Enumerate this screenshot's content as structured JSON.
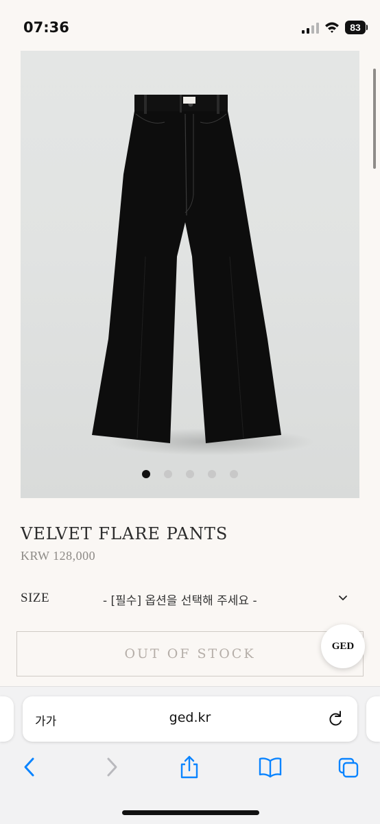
{
  "status_bar": {
    "time": "07:36",
    "battery": "83"
  },
  "product": {
    "title": "VELVET FLARE PANTS",
    "price": "KRW 128,000",
    "image_label_icon": "ged-label-tag",
    "gallery": {
      "slide_count": 5,
      "active_index": 0
    }
  },
  "options": {
    "size_label": "SIZE",
    "size_select_value": "- [필수] 옵션을 선택해 주세요 -"
  },
  "cta": {
    "out_of_stock_label": "OUT OF STOCK"
  },
  "chat_bubble": {
    "label": "GED"
  },
  "browser": {
    "text_size_label": "가가",
    "url": "ged.kr",
    "icons": [
      "back-icon",
      "forward-icon",
      "share-icon",
      "bookmarks-icon",
      "tabs-icon",
      "reload-icon"
    ]
  },
  "colors": {
    "page_bg": "#faf7f4",
    "accent_link": "#0a84ff",
    "muted_text": "#8d8a86"
  }
}
